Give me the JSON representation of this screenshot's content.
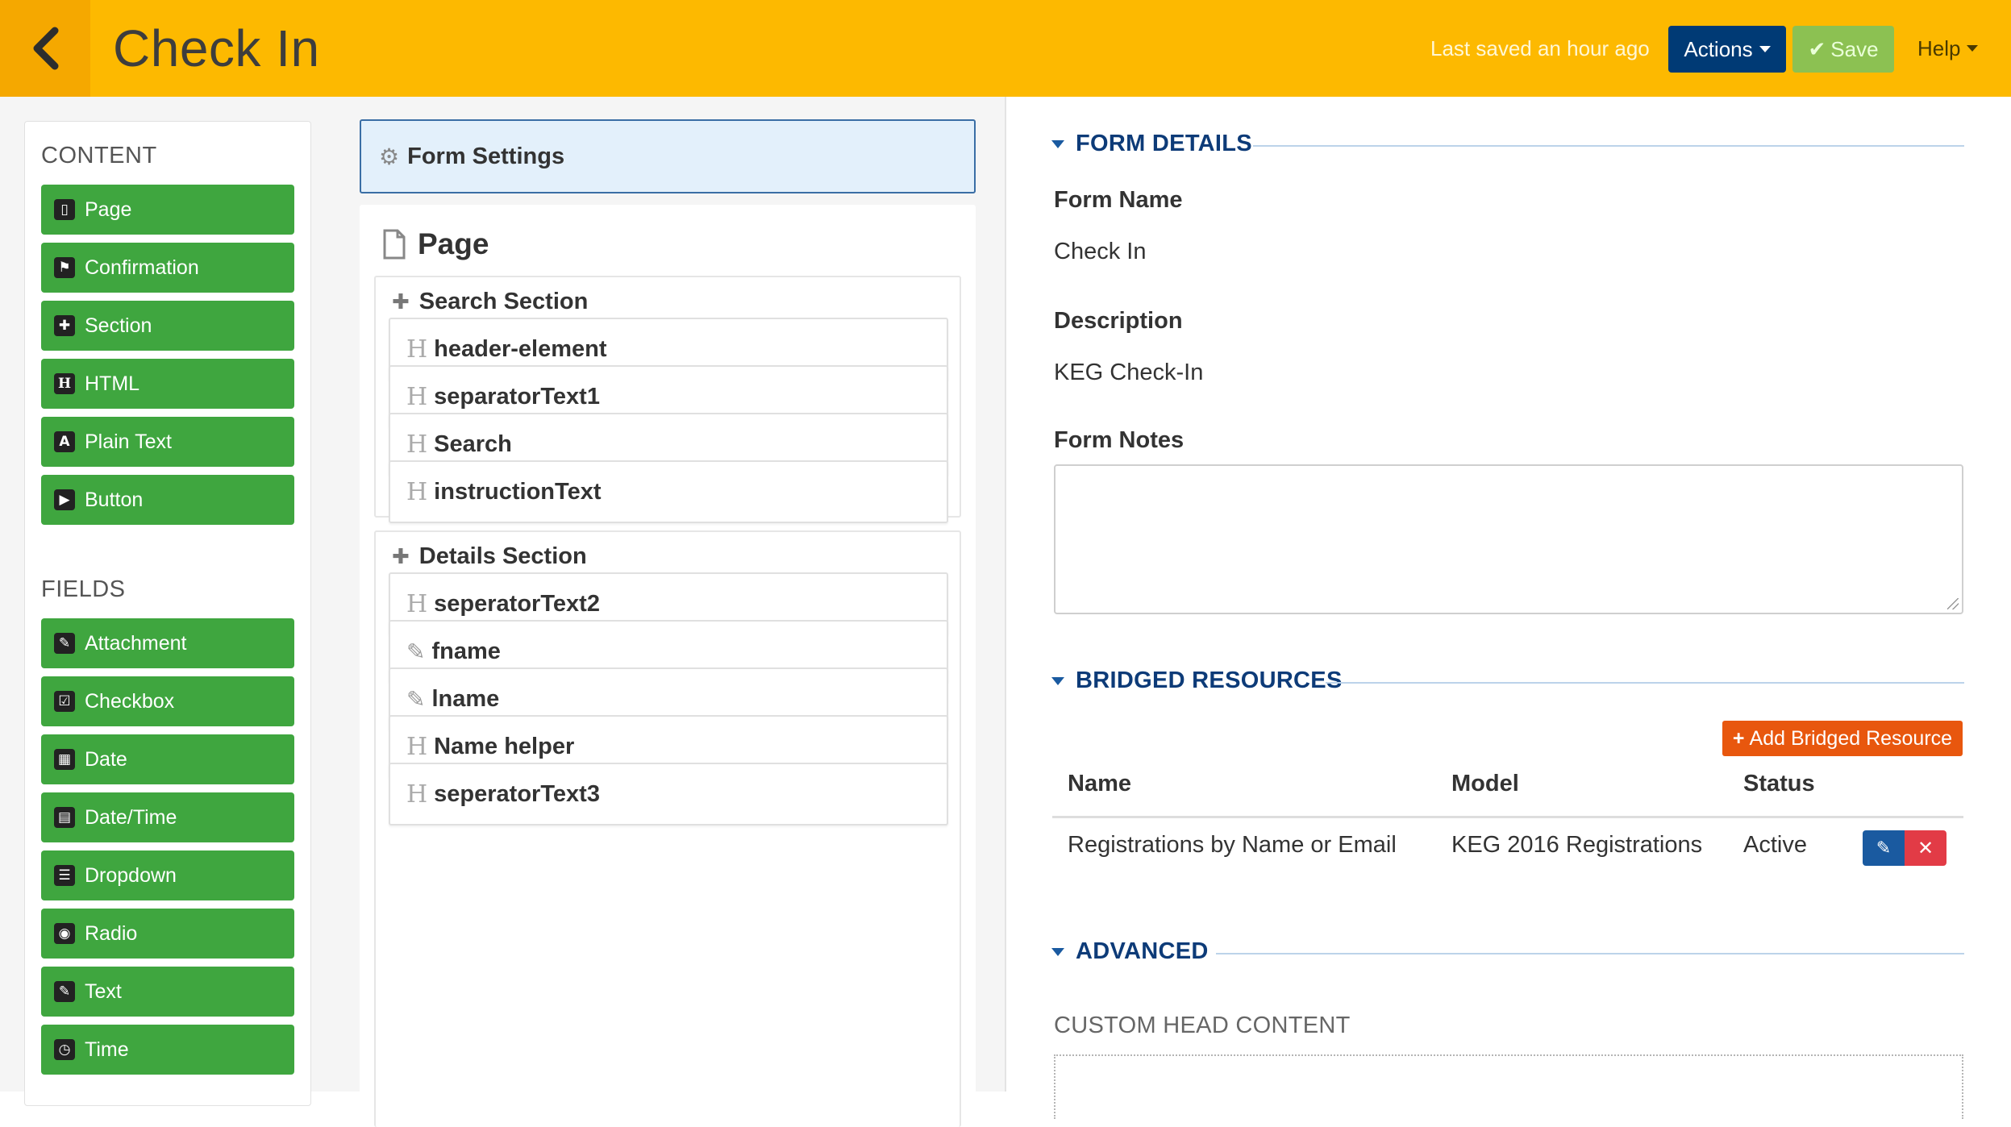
{
  "header": {
    "title": "Check In",
    "last_saved": "Last saved an hour ago",
    "actions_label": "Actions",
    "save_label": "Save",
    "help_label": "Help",
    "colors": {
      "bar": "#fdb900",
      "actions": "#003a75",
      "save": "#8cc152"
    }
  },
  "palette": {
    "content_heading": "CONTENT",
    "content_items": [
      {
        "label": "Page",
        "icon": "page-icon"
      },
      {
        "label": "Confirmation",
        "icon": "flag-icon"
      },
      {
        "label": "Section",
        "icon": "puzzle-icon"
      },
      {
        "label": "HTML",
        "icon": "html-icon"
      },
      {
        "label": "Plain Text",
        "icon": "font-icon"
      },
      {
        "label": "Button",
        "icon": "play-icon"
      }
    ],
    "fields_heading": "FIELDS",
    "field_items": [
      {
        "label": "Attachment",
        "icon": "paperclip-icon"
      },
      {
        "label": "Checkbox",
        "icon": "checkbox-icon"
      },
      {
        "label": "Date",
        "icon": "calendar-icon"
      },
      {
        "label": "Date/Time",
        "icon": "calendar-clock-icon"
      },
      {
        "label": "Dropdown",
        "icon": "list-icon"
      },
      {
        "label": "Radio",
        "icon": "toggle-icon"
      },
      {
        "label": "Text",
        "icon": "edit-icon"
      },
      {
        "label": "Time",
        "icon": "clock-icon"
      }
    ],
    "button_color": "#3fa63f"
  },
  "builder": {
    "form_settings_label": "Form Settings",
    "page_label": "Page",
    "sections": [
      {
        "title": "Search Section",
        "elements": [
          {
            "label": "header-element",
            "type": "html"
          },
          {
            "label": "separatorText1",
            "type": "html"
          },
          {
            "label": "Search",
            "type": "html"
          },
          {
            "label": "instructionText",
            "type": "html"
          }
        ]
      },
      {
        "title": "Details Section",
        "elements": [
          {
            "label": "seperatorText2",
            "type": "html"
          },
          {
            "label": "fname",
            "type": "text"
          },
          {
            "label": "lname",
            "type": "text"
          },
          {
            "label": "Name helper",
            "type": "html"
          },
          {
            "label": "seperatorText3",
            "type": "html"
          }
        ]
      }
    ]
  },
  "details": {
    "form_details_heading": "FORM DETAILS",
    "form_name_label": "Form Name",
    "form_name_value": "Check In",
    "description_label": "Description",
    "description_value": "KEG Check-In",
    "form_notes_label": "Form Notes",
    "form_notes_value": "",
    "bridged_heading": "BRIDGED RESOURCES",
    "add_bridged_label": "Add Bridged Resource",
    "table_headers": {
      "name": "Name",
      "model": "Model",
      "status": "Status"
    },
    "rows": [
      {
        "name": "Registrations by Name or Email",
        "model": "KEG 2016 Registrations",
        "status": "Active"
      }
    ],
    "advanced_heading": "ADVANCED",
    "custom_head_label": "CUSTOM HEAD CONTENT"
  }
}
